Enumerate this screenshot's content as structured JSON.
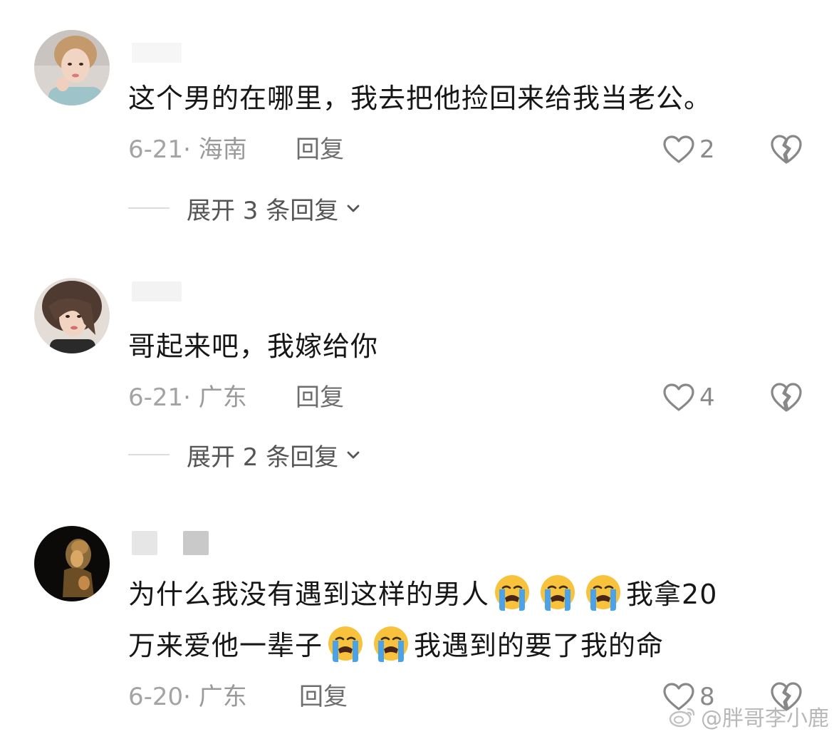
{
  "comments": [
    {
      "avatar": "woman-portrait-avatar",
      "text": "这个男的在哪里，我去把他捡回来给我当老公。",
      "date": "6-21",
      "location": "海南",
      "reply_label": "回复",
      "likes": "2",
      "expand_label": "展开 3 条回复"
    },
    {
      "avatar": "woman-portrait-avatar",
      "text": "哥起来吧，我嫁给你",
      "date": "6-21",
      "location": "广东",
      "reply_label": "回复",
      "likes": "4",
      "expand_label": "展开 2 条回复"
    },
    {
      "avatar": "buddha-statue-avatar",
      "text_parts": [
        "为什么我没有遇到这样的男人",
        "我拿20",
        "万来爱他一辈子",
        "我遇到的要了我的命"
      ],
      "emoji": "loudly-crying-face",
      "date": "6-20",
      "location": "广东",
      "reply_label": "回复",
      "likes": "8"
    }
  ],
  "watermark": "@胖哥李小鹿",
  "colors": {
    "text": "#161616",
    "meta": "#9a9a9a",
    "reply": "#6e6e6e",
    "expand": "#555555",
    "icon": "#888888"
  }
}
